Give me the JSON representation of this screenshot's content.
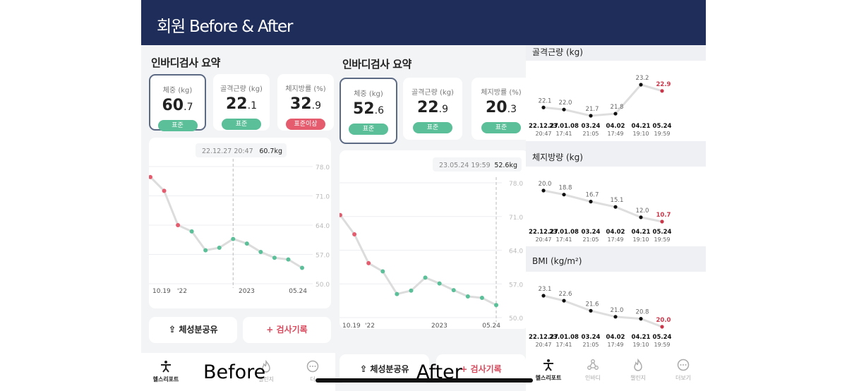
{
  "header": {
    "title": "회원 Before & After"
  },
  "summary_title": "인바디검사 요약",
  "before": {
    "cards": [
      {
        "label": "체중 (kg)",
        "int": "60",
        "dec": ".7",
        "badge": "표준",
        "high": false
      },
      {
        "label": "골격근량 (kg)",
        "int": "22",
        "dec": ".1",
        "badge": "표준",
        "high": false
      },
      {
        "label": "체지방률 (%)",
        "int": "32",
        "dec": ".9",
        "badge": "표준이상",
        "high": true
      }
    ],
    "tooltip": {
      "date": "22.12.27 20:47",
      "value": "60.7kg"
    },
    "x_labels": [
      "10.19",
      "'22",
      "2023",
      "05.24"
    ],
    "share_label": "체성분공유",
    "record_label": "+ 검사기록",
    "overlay": "Before"
  },
  "after": {
    "cards": [
      {
        "label": "체중 (kg)",
        "int": "52",
        "dec": ".6",
        "badge": "표준",
        "high": false
      },
      {
        "label": "골격근량 (kg)",
        "int": "22",
        "dec": ".9",
        "badge": "표준",
        "high": false
      },
      {
        "label": "체지방률 (%)",
        "int": "20",
        "dec": ".3",
        "badge": "표준",
        "high": false
      }
    ],
    "tooltip": {
      "date": "23.05.24 19:59",
      "value": "52.6kg"
    },
    "x_labels": [
      "10.19",
      "'22",
      "2023",
      "05.24"
    ],
    "share_label": "체성분공유",
    "record_label": "+ 검사기록",
    "overlay": "After"
  },
  "tabs": {
    "health_report": "헬스리포트",
    "inbody": "인바디",
    "challenge": "챌린지",
    "more": "더보기",
    "more_truncated": "더"
  },
  "chart_data": [
    {
      "type": "line",
      "title": "",
      "ylim": [
        50,
        78
      ],
      "y_ticks": [
        "78.0",
        "71.0",
        "64.0",
        "57.0",
        "50.0"
      ],
      "values": [
        75.5,
        72.2,
        64.0,
        62.5,
        58.0,
        58.6,
        60.7,
        59.6,
        57.6,
        56.2,
        55.8,
        53.8
      ],
      "highlight_index": 6
    },
    {
      "type": "line",
      "title": "",
      "ylim": [
        50,
        78
      ],
      "y_ticks": [
        "78.0",
        "71.0",
        "64.0",
        "57.0",
        "50.0"
      ],
      "values": [
        71.3,
        67.3,
        61.3,
        59.6,
        54.9,
        55.6,
        58.3,
        57.1,
        55.7,
        54.4,
        54.1,
        52.6
      ],
      "highlight_index": 11
    },
    {
      "type": "line",
      "title": "골격근량 (kg)",
      "x": [
        "22.12.27",
        "23.01.08",
        "03.24",
        "04.02",
        "04.21",
        "05.24"
      ],
      "x_times": [
        "20:47",
        "17:41",
        "21:05",
        "17:49",
        "19:10",
        "19:59"
      ],
      "values": [
        22.1,
        22.0,
        21.7,
        21.8,
        23.2,
        22.9
      ],
      "labels": [
        "22.1",
        "22.0",
        "21.7",
        "21.8",
        "23.2",
        "22.9"
      ]
    },
    {
      "type": "line",
      "title": "체지방량 (kg)",
      "x": [
        "22.12.27",
        "23.01.08",
        "03.24",
        "04.02",
        "04.21",
        "05.24"
      ],
      "x_times": [
        "20:47",
        "17:41",
        "21:05",
        "17:49",
        "19:10",
        "19:59"
      ],
      "values": [
        20.0,
        18.8,
        16.7,
        15.1,
        12.0,
        10.7
      ],
      "labels": [
        "20.0",
        "18.8",
        "16.7",
        "15.1",
        "12.0",
        "10.7"
      ]
    },
    {
      "type": "line",
      "title": "BMI (kg/m²)",
      "x": [
        "22.12.27",
        "23.01.08",
        "03.24",
        "04.02",
        "04.21",
        "05.24"
      ],
      "x_times": [
        "20:47",
        "17:41",
        "21:05",
        "17:49",
        "19:10",
        "19:59"
      ],
      "values": [
        23.1,
        22.6,
        21.6,
        21.0,
        20.8,
        20.0
      ],
      "labels": [
        "23.1",
        "22.6",
        "21.6",
        "21.0",
        "20.8",
        "20.0"
      ]
    }
  ],
  "colors": {
    "header": "#1e2d5a",
    "green": "#5bbf99",
    "red": "#e45c6e",
    "selected_border": "#5d6a84"
  }
}
